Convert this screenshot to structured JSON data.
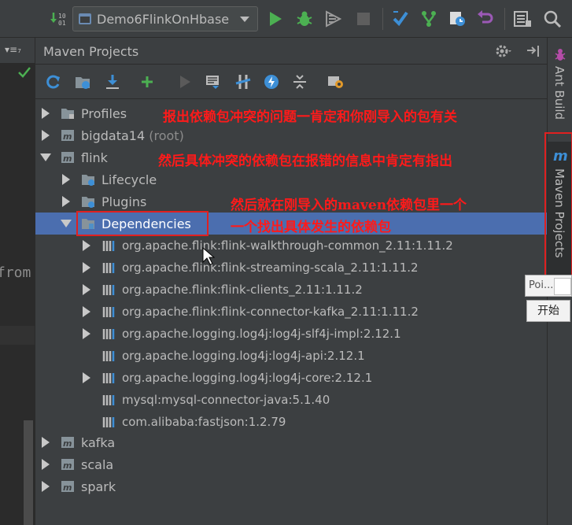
{
  "toolbar": {
    "run_config": "Demo6FlinkOnHbase",
    "icons": [
      "build-icon",
      "run-icon",
      "debug-icon",
      "coverage-icon",
      "stop-icon",
      "vcs-update-icon",
      "vcs-branch-icon",
      "vcs-history-icon",
      "vcs-revert-icon",
      "project-structure-icon",
      "search-icon"
    ]
  },
  "editor": {
    "partial_text": "from"
  },
  "panel": {
    "title": "Maven Projects",
    "toolbar_icons": [
      "reimport-icon",
      "generate-sources-icon",
      "download-icon",
      "add-icon",
      "run-goal-icon",
      "toggle-offline-icon",
      "skip-tests-icon",
      "lifecycle-icon",
      "show-dependencies-icon",
      "collapse-all-icon",
      "settings-icon"
    ]
  },
  "tree": {
    "profiles": "Profiles",
    "bigdata14": "bigdata14",
    "bigdata14_suffix": "(root)",
    "flink": "flink",
    "lifecycle": "Lifecycle",
    "plugins": "Plugins",
    "dependencies": "Dependencies",
    "deps": [
      "org.apache.flink:flink-walkthrough-common_2.11:1.11.2",
      "org.apache.flink:flink-streaming-scala_2.11:1.11.2",
      "org.apache.flink:flink-clients_2.11:1.11.2",
      "org.apache.flink:flink-connector-kafka_2.11:1.11.2",
      "org.apache.logging.log4j:log4j-slf4j-impl:2.12.1",
      "org.apache.logging.log4j:log4j-api:2.12.1",
      "org.apache.logging.log4j:log4j-core:2.12.1",
      "mysql:mysql-connector-java:5.1.40",
      "com.alibaba:fastjson:1.2.79"
    ],
    "kafka": "kafka",
    "scala": "scala",
    "spark": "spark"
  },
  "annotations": {
    "line1": "报出依赖包冲突的问题一肯定和你刚导入的包有关",
    "line2": "然后具体冲突的依赖包在报错的信息中肯定有指出",
    "line3": "然后就在刚导入的maven依赖包里一个",
    "line4": "一个找出具体发生的依赖包"
  },
  "sidebar": {
    "ant_build": "Ant Build",
    "maven_projects": "Maven Projects",
    "maven_glyph": "m"
  },
  "popup": {
    "input_text": "Poi...",
    "button_label": "开始"
  },
  "colors": {
    "selection": "#4b6eaf",
    "annotation": "#ff1a1a",
    "run_green": "#4cb052"
  }
}
